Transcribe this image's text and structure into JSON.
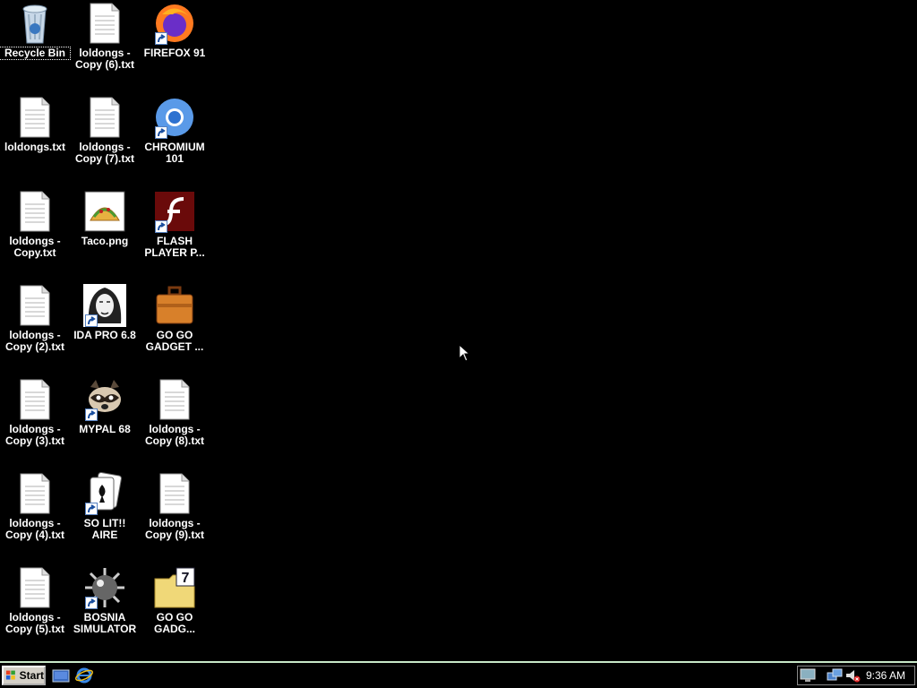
{
  "desktop": {
    "icons": [
      {
        "label": "Recycle Bin",
        "icon": "recycle-bin-icon"
      },
      {
        "label": "loldongs -\nCopy (6).txt",
        "icon": "text-file-icon"
      },
      {
        "label": "FIREFOX 91",
        "icon": "firefox-icon"
      },
      {
        "label": "loldongs.txt",
        "icon": "text-file-icon"
      },
      {
        "label": "loldongs -\nCopy (7).txt",
        "icon": "text-file-icon"
      },
      {
        "label": "CHROMIUM\n101",
        "icon": "chromium-icon"
      },
      {
        "label": "loldongs -\nCopy.txt",
        "icon": "text-file-icon"
      },
      {
        "label": "Taco.png",
        "icon": "taco-image-icon"
      },
      {
        "label": "FLASH\nPLAYER P...",
        "icon": "flash-player-icon"
      },
      {
        "label": "loldongs -\nCopy (2).txt",
        "icon": "text-file-icon"
      },
      {
        "label": "IDA PRO 6.8",
        "icon": "ida-pro-icon"
      },
      {
        "label": "GO GO\nGADGET ...",
        "icon": "briefcase-icon"
      },
      {
        "label": "loldongs -\nCopy (3).txt",
        "icon": "text-file-icon"
      },
      {
        "label": "MYPAL 68",
        "icon": "raccoon-icon"
      },
      {
        "label": "loldongs -\nCopy (8).txt",
        "icon": "text-file-icon"
      },
      {
        "label": "loldongs -\nCopy (4).txt",
        "icon": "text-file-icon"
      },
      {
        "label": "SO LIT!!\nAIRE",
        "icon": "solitaire-icon"
      },
      {
        "label": "loldongs -\nCopy (9).txt",
        "icon": "text-file-icon"
      },
      {
        "label": "loldongs -\nCopy (5).txt",
        "icon": "text-file-icon"
      },
      {
        "label": "BOSNIA\nSIMULATOR",
        "icon": "minesweeper-icon"
      },
      {
        "label": "GO GO\nGADG...",
        "icon": "7zip-folder-icon"
      }
    ]
  },
  "taskbar": {
    "start_label": "Start",
    "quick_launch": [
      "show-desktop-icon",
      "internet-explorer-icon"
    ],
    "tray_icons": [
      "monitor-icon",
      "network-icon",
      "volume-muted-icon"
    ],
    "clock": "9:36 AM"
  }
}
